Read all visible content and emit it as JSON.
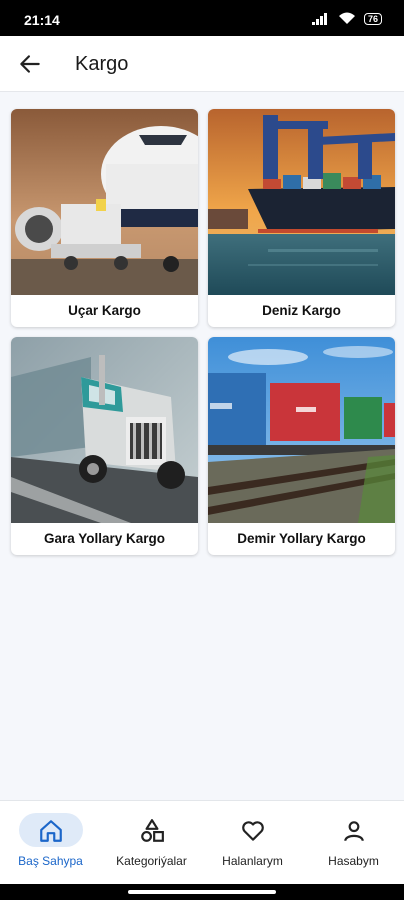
{
  "status_bar": {
    "time": "21:14",
    "battery": "76",
    "icons": [
      "signal-icon",
      "wifi-icon",
      "battery-icon"
    ]
  },
  "app_bar": {
    "title": "Kargo",
    "back_icon": "arrow-left-icon"
  },
  "categories": [
    {
      "label": "Uçar Kargo",
      "image": "cargo-airplane-image"
    },
    {
      "label": "Deniz Kargo",
      "image": "container-ship-image"
    },
    {
      "label": "Gara Yollary Kargo",
      "image": "truck-image"
    },
    {
      "label": "Demir Yollary Kargo",
      "image": "freight-train-image"
    }
  ],
  "bottom_nav": {
    "items": [
      {
        "label": "Baş Sahypa",
        "icon": "home-icon",
        "active": true
      },
      {
        "label": "Kategoriýalar",
        "icon": "shapes-icon",
        "active": false
      },
      {
        "label": "Halanlarym",
        "icon": "heart-icon",
        "active": false
      },
      {
        "label": "Hasabym",
        "icon": "user-icon",
        "active": false
      }
    ]
  },
  "colors": {
    "accent": "#1b66c9",
    "active_pill": "#dfeaf8",
    "background": "#f5f7fb"
  }
}
